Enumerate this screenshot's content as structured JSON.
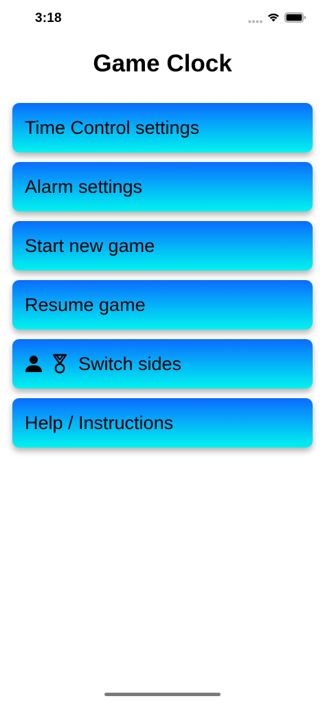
{
  "status_bar": {
    "time": "3:18",
    "icons": [
      "signal-dots-icon",
      "wifi-icon",
      "battery-icon"
    ]
  },
  "header": {
    "title": "Game Clock"
  },
  "menu": {
    "items": [
      {
        "label": "Time Control settings"
      },
      {
        "label": "Alarm settings"
      },
      {
        "label": "Start new game"
      },
      {
        "label": "Resume game"
      },
      {
        "label": "Switch sides",
        "icons": [
          "person-icon",
          "medal-icon"
        ]
      },
      {
        "label": "Help / Instructions"
      }
    ]
  },
  "colors": {
    "button_gradient_top": "#0a6cff",
    "button_gradient_bottom": "#00f3ee",
    "background": "#ffffff",
    "text": "#000000"
  }
}
